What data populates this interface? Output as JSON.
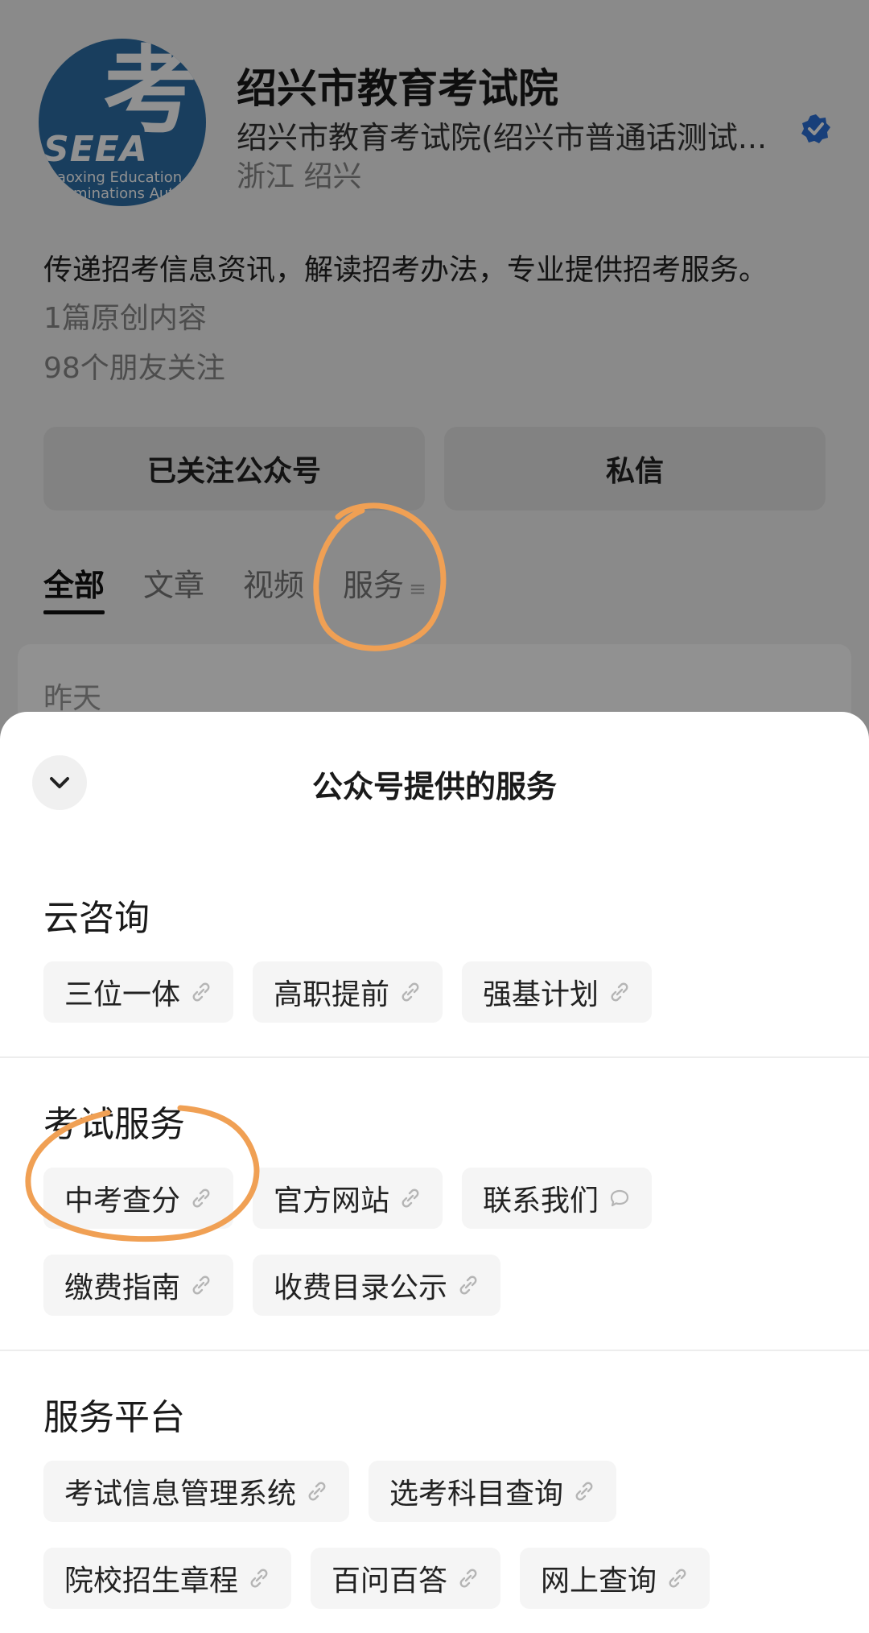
{
  "profile": {
    "logo_text": "SEEA",
    "logo_sub1": "Shaoxing Education",
    "logo_sub2": "Examinations Authority",
    "name": "绍兴市教育考试院",
    "org": "绍兴市教育考试院(绍兴市普通话测试...",
    "location": "浙江 绍兴",
    "description": "传递招考信息资讯，解读招考办法，专业提供招考服务。",
    "original_count": "1篇原创内容",
    "friends_following": "98个朋友关注",
    "follow_button": "已关注公众号",
    "message_button": "私信",
    "tabs": [
      "全部",
      "文章",
      "视频",
      "服务"
    ],
    "feed_date": "昨天"
  },
  "sheet": {
    "title": "公众号提供的服务",
    "sections": [
      {
        "title": "云咨询",
        "items": [
          "三位一体",
          "高职提前",
          "强基计划"
        ]
      },
      {
        "title": "考试服务",
        "items": [
          "中考查分",
          "官方网站",
          "联系我们",
          "缴费指南",
          "收费目录公示"
        ]
      },
      {
        "title": "服务平台",
        "items": [
          "考试信息管理系统",
          "选考科目查询",
          "院校招生章程",
          "百问百答",
          "网上查询"
        ]
      }
    ]
  },
  "colors": {
    "annotation": "#f0a054",
    "verified": "#2b6fd6"
  }
}
